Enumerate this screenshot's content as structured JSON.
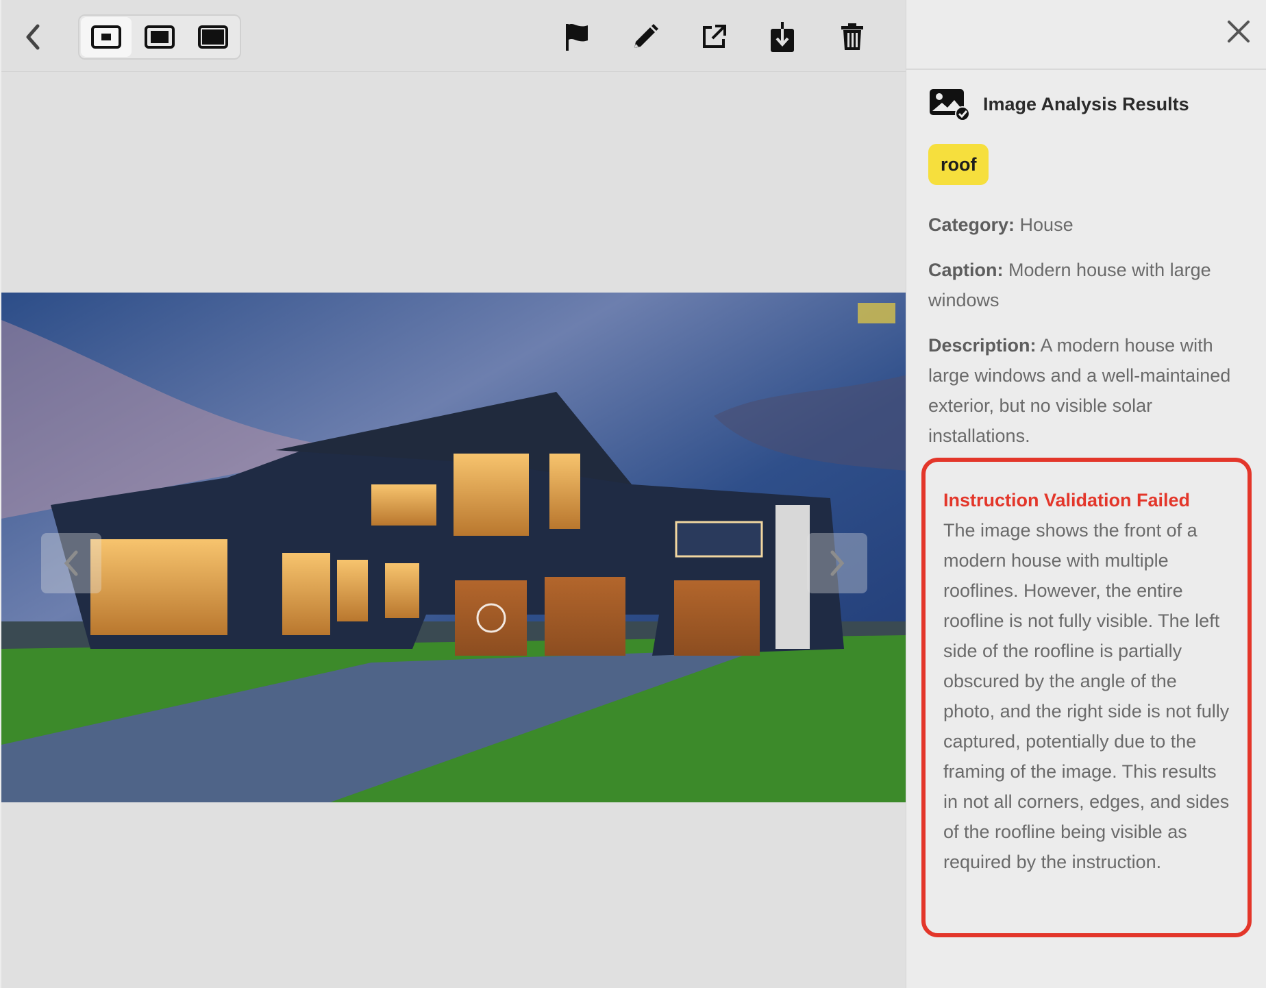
{
  "toolbar": {
    "back_icon": "chevron-left-icon",
    "size_options": [
      "small-view-icon",
      "medium-view-icon",
      "large-view-icon"
    ],
    "active_size": "small",
    "tools": [
      "flag-icon",
      "pencil-icon",
      "external-link-icon",
      "download-icon",
      "trash-icon"
    ]
  },
  "image": {
    "subject": "Modern house at dusk with three garage doors",
    "watermark_icon": "logo-watermark"
  },
  "panel": {
    "close_icon": "close-icon",
    "title": "Image Analysis Results",
    "tag": "roof",
    "category_label": "Category:",
    "category_value": "House",
    "caption_label": "Caption:",
    "caption_value": "Modern house with large windows",
    "description_label": "Description:",
    "description_value": "A modern house with large windows and a well-maintained exterior, but no visible solar installations.",
    "alert_title": "Instruction Validation Failed",
    "alert_body": "The image shows the front of a modern house with multiple rooflines. However, the entire roofline is not fully visible. The left side of the roofline is partially obscured by the angle of the photo, and the right side is not fully captured, potentially due to the framing of the image. This results in not all corners, edges, and sides of the roofline being visible as required by the instruction."
  },
  "colors": {
    "tag_bg": "#f6df3d",
    "alert": "#e3362a",
    "panel_bg": "#ececec",
    "viewer_bg": "#e0e0e0"
  }
}
